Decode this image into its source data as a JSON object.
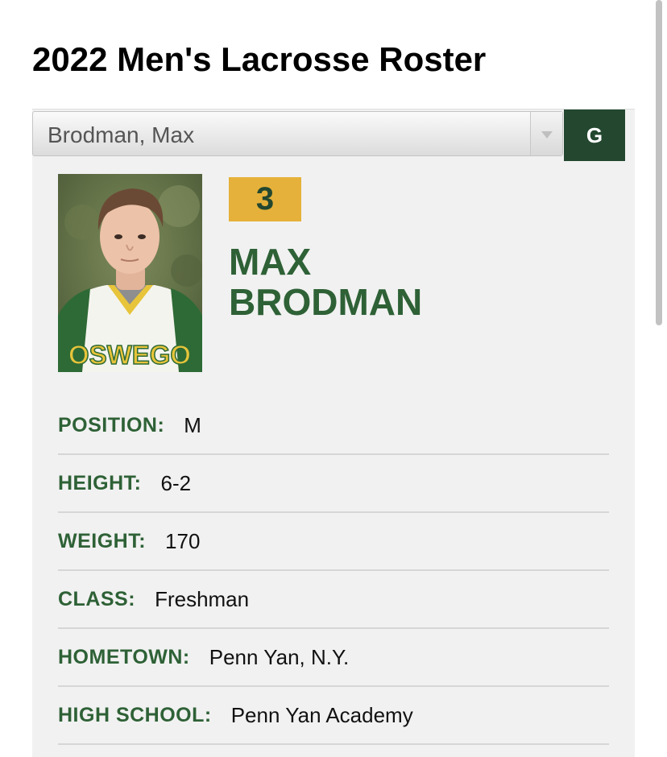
{
  "page": {
    "title": "2022 Men's Lacrosse Roster"
  },
  "roster_select": {
    "selected": "Brodman, Max",
    "go_label": "G"
  },
  "player": {
    "number": "3",
    "first_name": "MAX",
    "last_name": "BRODMAN",
    "photo_jersey_text": "OSWEGO"
  },
  "bio": [
    {
      "label": "POSITION:",
      "value": "M"
    },
    {
      "label": "HEIGHT:",
      "value": "6-2"
    },
    {
      "label": "WEIGHT:",
      "value": "170"
    },
    {
      "label": "CLASS:",
      "value": "Freshman"
    },
    {
      "label": "HOMETOWN:",
      "value": "Penn Yan, N.Y."
    },
    {
      "label": "HIGH SCHOOL:",
      "value": "Penn Yan Academy"
    }
  ],
  "colors": {
    "brand_green": "#23472f",
    "label_green": "#2e6136",
    "gold": "#e5b13a",
    "panel_bg": "#f1f1f1"
  }
}
